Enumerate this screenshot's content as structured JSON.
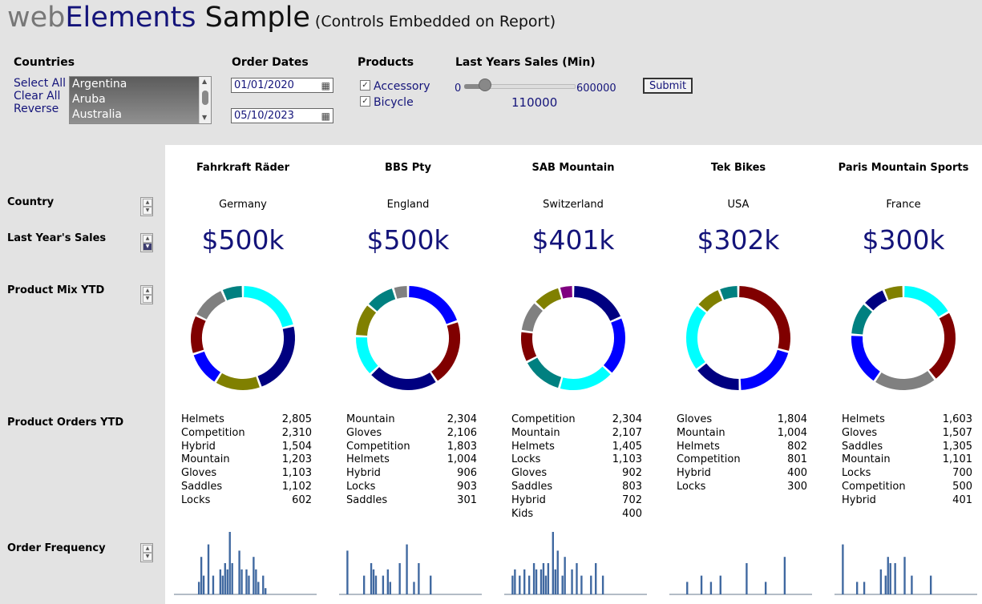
{
  "title": {
    "web": "web",
    "elements": "Elements",
    "sample": "Sample",
    "subtitle": "(Controls Embedded on Report)"
  },
  "filters": {
    "countries": {
      "label": "Countries",
      "select_all": "Select All",
      "clear_all": "Clear All",
      "reverse": "Reverse",
      "options": [
        "Argentina",
        "Aruba",
        "Australia"
      ]
    },
    "order_dates": {
      "label": "Order Dates",
      "start": "01/01/2020",
      "end": "05/10/2023"
    },
    "products": {
      "label": "Products",
      "items": [
        {
          "label": "Accessory",
          "checked": true
        },
        {
          "label": "Bicycle",
          "checked": true
        }
      ]
    },
    "sales_min": {
      "label": "Last Years Sales (Min)",
      "min_label": "0",
      "max_label": "600000",
      "min": 0,
      "max": 600000,
      "value": 110000,
      "value_label": "110000"
    },
    "submit": "Submit"
  },
  "rows": {
    "country": "Country",
    "last_year_sales": "Last Year's Sales",
    "product_mix": "Product Mix YTD",
    "product_orders": "Product Orders YTD",
    "order_frequency": "Order Frequency"
  },
  "colors": {
    "navy": "#14147a",
    "cyan": "#00ffff",
    "darkred": "#800000",
    "blue": "#0000ff",
    "darkblue": "#000080",
    "olive": "#808000",
    "gray": "#808080",
    "teal": "#008080",
    "purple": "#800080"
  },
  "customers": [
    {
      "name": "Fahrkraft Räder",
      "country": "Germany",
      "sales": "$500k",
      "mix": [
        {
          "c": "#00ffff",
          "v": 19
        },
        {
          "c": "#000080",
          "v": 21
        },
        {
          "c": "#808000",
          "v": 13
        },
        {
          "c": "#0000ff",
          "v": 10
        },
        {
          "c": "#800000",
          "v": 11
        },
        {
          "c": "#808080",
          "v": 10
        },
        {
          "c": "#008080",
          "v": 6
        }
      ],
      "orders": [
        [
          "Helmets",
          "2,805"
        ],
        [
          "Competition",
          "2,310"
        ],
        [
          "Hybrid",
          "1,504"
        ],
        [
          "Mountain",
          "1,203"
        ],
        [
          "Gloves",
          "1,103"
        ],
        [
          "Saddles",
          "1,102"
        ],
        [
          "Locks",
          "602"
        ]
      ],
      "freq": [
        0,
        0,
        0,
        0,
        0,
        0,
        0,
        0,
        0,
        0,
        2,
        6,
        3,
        0,
        8,
        0,
        3,
        0,
        0,
        4,
        3,
        5,
        4,
        10,
        5,
        0,
        0,
        7,
        4,
        0,
        4,
        3,
        0,
        6,
        4,
        2,
        0,
        3,
        1,
        0,
        0,
        0,
        0,
        0,
        0,
        0,
        0,
        0,
        0,
        0,
        0,
        0,
        0,
        0,
        0,
        0,
        0,
        0,
        0,
        0
      ]
    },
    {
      "name": "BBS Pty",
      "country": "England",
      "sales": "$500k",
      "mix": [
        {
          "c": "#0000ff",
          "v": 17
        },
        {
          "c": "#800000",
          "v": 18
        },
        {
          "c": "#000080",
          "v": 19
        },
        {
          "c": "#00ffff",
          "v": 11
        },
        {
          "c": "#808000",
          "v": 9
        },
        {
          "c": "#008080",
          "v": 8
        },
        {
          "c": "#808080",
          "v": 4
        }
      ],
      "orders": [
        [
          "Mountain",
          "2,304"
        ],
        [
          "Gloves",
          "2,106"
        ],
        [
          "Competition",
          "1,803"
        ],
        [
          "Helmets",
          "1,004"
        ],
        [
          "Hybrid",
          "906"
        ],
        [
          "Locks",
          "903"
        ],
        [
          "Saddles",
          "301"
        ]
      ],
      "freq": [
        0,
        0,
        0,
        7,
        0,
        0,
        0,
        0,
        0,
        0,
        3,
        0,
        0,
        5,
        4,
        3,
        0,
        0,
        3,
        0,
        4,
        2,
        0,
        0,
        0,
        5,
        0,
        0,
        8,
        0,
        0,
        2,
        0,
        5,
        0,
        0,
        0,
        0,
        3,
        0,
        0,
        0,
        0,
        0,
        0,
        0,
        0,
        0,
        0,
        0,
        0,
        0,
        0,
        0,
        0,
        0,
        0,
        0,
        0,
        0
      ]
    },
    {
      "name": "SAB Mountain",
      "country": "Switzerland",
      "sales": "$401k",
      "mix": [
        {
          "c": "#000080",
          "v": 17
        },
        {
          "c": "#0000ff",
          "v": 17
        },
        {
          "c": "#00ffff",
          "v": 16
        },
        {
          "c": "#008080",
          "v": 12
        },
        {
          "c": "#800000",
          "v": 9
        },
        {
          "c": "#808080",
          "v": 9
        },
        {
          "c": "#808000",
          "v": 8
        },
        {
          "c": "#800080",
          "v": 4
        }
      ],
      "orders": [
        [
          "Competition",
          "2,304"
        ],
        [
          "Mountain",
          "2,107"
        ],
        [
          "Helmets",
          "1,405"
        ],
        [
          "Locks",
          "1,103"
        ],
        [
          "Gloves",
          "902"
        ],
        [
          "Saddles",
          "803"
        ],
        [
          "Hybrid",
          "702"
        ],
        [
          "Kids",
          "400"
        ]
      ],
      "freq": [
        0,
        0,
        0,
        3,
        4,
        0,
        3,
        0,
        4,
        0,
        3,
        0,
        5,
        4,
        0,
        4,
        5,
        3,
        5,
        0,
        10,
        4,
        7,
        0,
        3,
        6,
        0,
        0,
        4,
        0,
        5,
        0,
        3,
        0,
        0,
        0,
        3,
        0,
        5,
        0,
        0,
        3,
        0,
        0,
        0,
        0,
        0,
        0,
        0,
        0,
        0,
        0,
        0,
        0,
        0,
        0,
        0,
        0,
        0,
        0
      ]
    },
    {
      "name": "Tek Bikes",
      "country": "USA",
      "sales": "$302k",
      "mix": [
        {
          "c": "#800000",
          "v": 29
        },
        {
          "c": "#0000ff",
          "v": 20
        },
        {
          "c": "#000080",
          "v": 15
        },
        {
          "c": "#00ffff",
          "v": 21
        },
        {
          "c": "#808000",
          "v": 8
        },
        {
          "c": "#008080",
          "v": 6
        }
      ],
      "orders": [
        [
          "Gloves",
          "1,804"
        ],
        [
          "Mountain",
          "1,004"
        ],
        [
          "Helmets",
          "802"
        ],
        [
          "Competition",
          "801"
        ],
        [
          "Hybrid",
          "400"
        ],
        [
          "Locks",
          "300"
        ]
      ],
      "freq": [
        0,
        0,
        0,
        0,
        0,
        0,
        0,
        2,
        0,
        0,
        0,
        0,
        0,
        3,
        0,
        0,
        0,
        2,
        0,
        0,
        0,
        3,
        0,
        0,
        0,
        0,
        0,
        0,
        0,
        0,
        0,
        0,
        5,
        0,
        0,
        0,
        0,
        0,
        0,
        0,
        2,
        0,
        0,
        0,
        0,
        0,
        0,
        0,
        6,
        0,
        0,
        0,
        0,
        0,
        0,
        0,
        0,
        0,
        0,
        0
      ]
    },
    {
      "name": "Paris Mountain Sports",
      "country": "France",
      "sales": "$300k",
      "mix": [
        {
          "c": "#00ffff",
          "v": 16
        },
        {
          "c": "#800000",
          "v": 22
        },
        {
          "c": "#808080",
          "v": 19
        },
        {
          "c": "#0000ff",
          "v": 16
        },
        {
          "c": "#008080",
          "v": 10
        },
        {
          "c": "#000080",
          "v": 7
        },
        {
          "c": "#808000",
          "v": 6
        }
      ],
      "orders": [
        [
          "Helmets",
          "1,603"
        ],
        [
          "Gloves",
          "1,507"
        ],
        [
          "Saddles",
          "1,305"
        ],
        [
          "Mountain",
          "1,101"
        ],
        [
          "Locks",
          "700"
        ],
        [
          "Competition",
          "500"
        ],
        [
          "Hybrid",
          "401"
        ]
      ],
      "freq": [
        0,
        0,
        0,
        8,
        0,
        0,
        0,
        0,
        0,
        2,
        0,
        0,
        2,
        0,
        0,
        0,
        0,
        0,
        0,
        4,
        0,
        3,
        6,
        5,
        0,
        5,
        0,
        0,
        0,
        6,
        0,
        0,
        3,
        0,
        0,
        0,
        0,
        0,
        0,
        0,
        3,
        0,
        0,
        0,
        0,
        0,
        0,
        0,
        0,
        0,
        0,
        0,
        0,
        0,
        0,
        0,
        0,
        0,
        0,
        0
      ]
    }
  ]
}
